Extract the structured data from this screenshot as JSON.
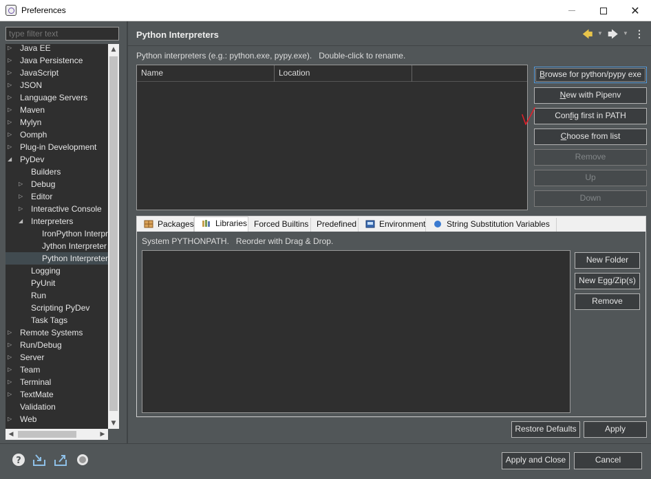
{
  "window": {
    "title": "Preferences"
  },
  "filter": {
    "placeholder": "type filter text"
  },
  "tree": {
    "items": [
      {
        "label": "Java EE",
        "level": 0,
        "state": "collapsed"
      },
      {
        "label": "Java Persistence",
        "level": 0,
        "state": "collapsed"
      },
      {
        "label": "JavaScript",
        "level": 0,
        "state": "collapsed"
      },
      {
        "label": "JSON",
        "level": 0,
        "state": "collapsed"
      },
      {
        "label": "Language Servers",
        "level": 0,
        "state": "collapsed"
      },
      {
        "label": "Maven",
        "level": 0,
        "state": "collapsed"
      },
      {
        "label": "Mylyn",
        "level": 0,
        "state": "collapsed"
      },
      {
        "label": "Oomph",
        "level": 0,
        "state": "collapsed"
      },
      {
        "label": "Plug-in Development",
        "level": 0,
        "state": "collapsed"
      },
      {
        "label": "PyDev",
        "level": 0,
        "state": "expanded"
      },
      {
        "label": "Builders",
        "level": 1,
        "state": "leaf"
      },
      {
        "label": "Debug",
        "level": 1,
        "state": "collapsed"
      },
      {
        "label": "Editor",
        "level": 1,
        "state": "collapsed"
      },
      {
        "label": "Interactive Console",
        "level": 1,
        "state": "collapsed"
      },
      {
        "label": "Interpreters",
        "level": 1,
        "state": "expanded"
      },
      {
        "label": "IronPython Interpreter",
        "level": 2,
        "state": "leaf"
      },
      {
        "label": "Jython Interpreter",
        "level": 2,
        "state": "leaf"
      },
      {
        "label": "Python Interpreter",
        "level": 2,
        "state": "leaf",
        "selected": true
      },
      {
        "label": "Logging",
        "level": 1,
        "state": "leaf"
      },
      {
        "label": "PyUnit",
        "level": 1,
        "state": "leaf"
      },
      {
        "label": "Run",
        "level": 1,
        "state": "leaf"
      },
      {
        "label": "Scripting PyDev",
        "level": 1,
        "state": "leaf"
      },
      {
        "label": "Task Tags",
        "level": 1,
        "state": "leaf"
      },
      {
        "label": "Remote Systems",
        "level": 0,
        "state": "collapsed"
      },
      {
        "label": "Run/Debug",
        "level": 0,
        "state": "collapsed"
      },
      {
        "label": "Server",
        "level": 0,
        "state": "collapsed"
      },
      {
        "label": "Team",
        "level": 0,
        "state": "collapsed"
      },
      {
        "label": "Terminal",
        "level": 0,
        "state": "collapsed"
      },
      {
        "label": "TextMate",
        "level": 0,
        "state": "collapsed"
      },
      {
        "label": "Validation",
        "level": 0,
        "state": "leaf"
      },
      {
        "label": "Web",
        "level": 0,
        "state": "collapsed"
      }
    ]
  },
  "page": {
    "title": "Python Interpreters",
    "description": "Python interpreters (e.g.: python.exe, pypy.exe).   Double-click to rename.",
    "table_columns": [
      "Name",
      "Location",
      ""
    ]
  },
  "interp_buttons": [
    {
      "label": "Browse for python/pypy exe",
      "mnemonic": "B",
      "enabled": true,
      "focused": true
    },
    {
      "label": "New with Pipenv",
      "mnemonic": "N",
      "enabled": true
    },
    {
      "label": "Config first in PATH",
      "mnemonic": "f",
      "enabled": true
    },
    {
      "label": "Choose from list",
      "mnemonic": "C",
      "enabled": true
    },
    {
      "label": "Remove",
      "enabled": false
    },
    {
      "label": "Up",
      "enabled": false
    },
    {
      "label": "Down",
      "enabled": false
    }
  ],
  "tabs": [
    {
      "label": "Packages",
      "icon": "packages-icon",
      "active": false
    },
    {
      "label": "Libraries",
      "icon": "libraries-icon",
      "active": true
    },
    {
      "label": "Forced Builtins",
      "icon": "",
      "active": false
    },
    {
      "label": "Predefined",
      "icon": "",
      "active": false
    },
    {
      "label": "Environment",
      "icon": "environment-icon",
      "active": false
    },
    {
      "label": "String Substitution Variables",
      "icon": "variables-icon",
      "active": false
    }
  ],
  "libraries": {
    "description": "System PYTHONPATH.   Reorder with Drag & Drop.",
    "buttons": [
      {
        "label": "New Folder"
      },
      {
        "label": "New Egg/Zip(s)"
      },
      {
        "label": "Remove",
        "mnemonic": "R"
      }
    ]
  },
  "footer": {
    "restore_defaults": "Restore Defaults",
    "apply": "Apply",
    "apply_and_close": "Apply and Close",
    "cancel": "Cancel"
  },
  "colors": {
    "background": "#515658",
    "field": "#2f2f2f",
    "text": "#dddddd",
    "annotation": "#e0202a",
    "focus": "#5aa0e0"
  }
}
